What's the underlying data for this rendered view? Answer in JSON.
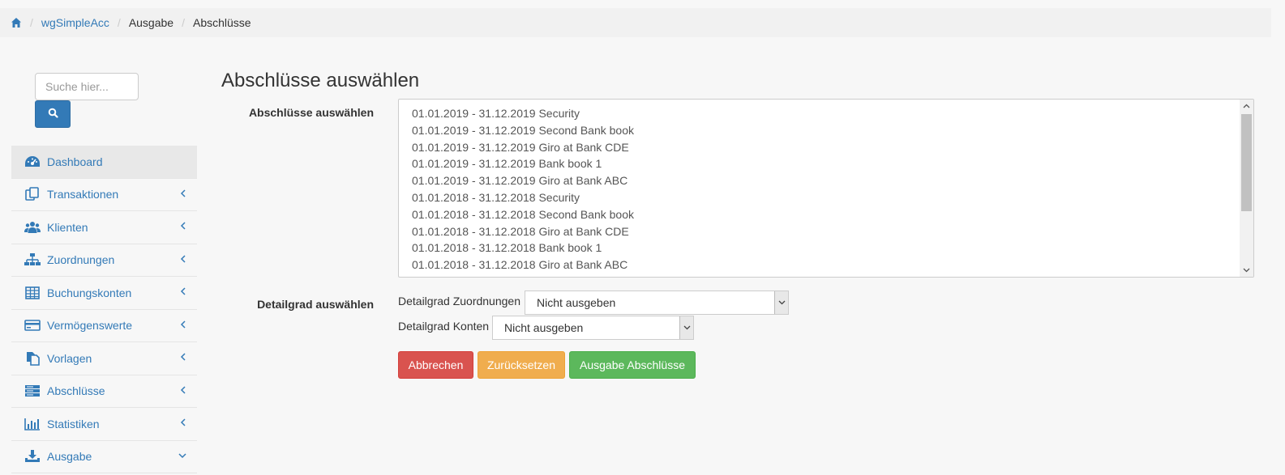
{
  "breadcrumb": {
    "home_icon": "home-icon",
    "items": [
      "wgSimpleAcc",
      "Ausgabe",
      "Abschlüsse"
    ]
  },
  "search": {
    "placeholder": "Suche hier...",
    "icon": "search-icon"
  },
  "sidebar": {
    "items": [
      {
        "label": "Dashboard",
        "icon": "dashboard-icon"
      },
      {
        "label": "Transaktionen",
        "icon": "copy-icon"
      },
      {
        "label": "Klienten",
        "icon": "users-icon"
      },
      {
        "label": "Zuordnungen",
        "icon": "sitemap-icon"
      },
      {
        "label": "Buchungskonten",
        "icon": "table-icon"
      },
      {
        "label": "Vermögenswerte",
        "icon": "credit-card-icon"
      },
      {
        "label": "Vorlagen",
        "icon": "files-icon"
      },
      {
        "label": "Abschlüsse",
        "icon": "server-icon"
      },
      {
        "label": "Statistiken",
        "icon": "bar-chart-icon"
      },
      {
        "label": "Ausgabe",
        "icon": "download-icon"
      }
    ]
  },
  "main": {
    "title": "Abschlüsse auswählen",
    "select_label": "Abschlüsse auswählen",
    "periods": [
      "01.01.2019 - 31.12.2019 Security",
      "01.01.2019 - 31.12.2019 Second Bank book",
      "01.01.2019 - 31.12.2019 Giro at Bank CDE",
      "01.01.2019 - 31.12.2019 Bank book 1",
      "01.01.2019 - 31.12.2019 Giro at Bank ABC",
      "01.01.2018 - 31.12.2018 Security",
      "01.01.2018 - 31.12.2018 Second Bank book",
      "01.01.2018 - 31.12.2018 Giro at Bank CDE",
      "01.01.2018 - 31.12.2018 Bank book 1",
      "01.01.2018 - 31.12.2018 Giro at Bank ABC"
    ],
    "detail_label": "Detailgrad auswählen",
    "detail_assignments_label": "Detailgrad Zuordnungen",
    "detail_assignments_value": "Nicht ausgeben",
    "detail_accounts_label": "Detailgrad Konten",
    "detail_accounts_value": "Nicht ausgeben",
    "buttons": {
      "cancel": "Abbrechen",
      "reset": "Zurücksetzen",
      "submit": "Ausgabe Abschlüsse"
    }
  },
  "colors": {
    "primary": "#337ab7",
    "danger": "#d9534f",
    "warning": "#f0ad4e",
    "success": "#5cb85c"
  }
}
